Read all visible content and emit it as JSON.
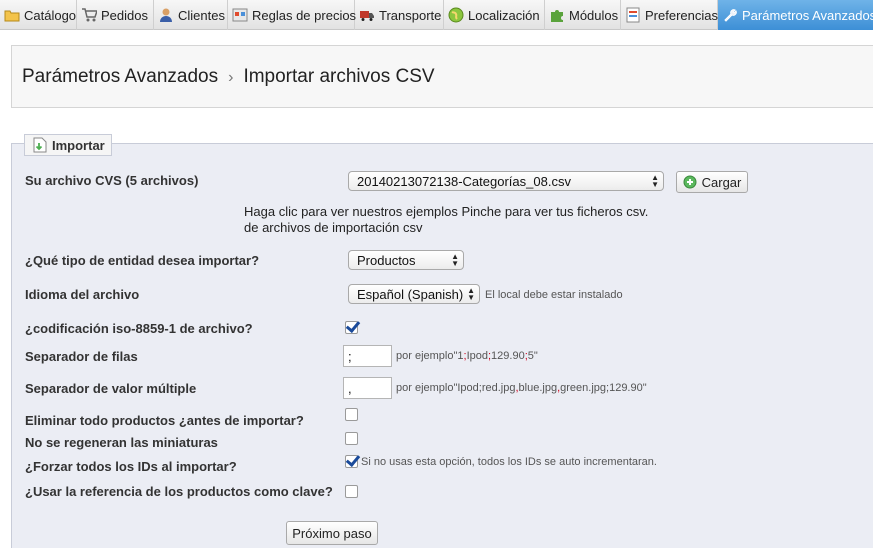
{
  "tabs": [
    {
      "label": "Catálogo",
      "icon": "folder-icon"
    },
    {
      "label": "Pedidos",
      "icon": "cart-icon"
    },
    {
      "label": "Clientes",
      "icon": "user-icon"
    },
    {
      "label": "Reglas de precios",
      "icon": "price-rules-icon"
    },
    {
      "label": "Transporte",
      "icon": "truck-icon"
    },
    {
      "label": "Localización",
      "icon": "globe-icon"
    },
    {
      "label": "Módulos",
      "icon": "puzzle-icon"
    },
    {
      "label": "Preferencias",
      "icon": "preferences-icon"
    },
    {
      "label": "Parámetros Avanzados",
      "icon": "wrench-icon",
      "active": true
    }
  ],
  "breadcrumb": {
    "parent": "Parámetros Avanzados",
    "separator": "›",
    "current": "Importar archivos CSV"
  },
  "panel": {
    "legend": "Importar"
  },
  "form": {
    "file_label": "Su archivo CVS (5 archivos)",
    "file_value": "20140213072138-Categorías_08.csv",
    "upload_button": "Cargar",
    "info_line1": "Haga clic para ver nuestros ejemplos Pinche para ver tus ficheros csv.",
    "info_line2": "de archivos de importación csv",
    "entity_label": "¿Qué tipo de entidad desea importar?",
    "entity_value": "Productos",
    "lang_label": "Idioma del archivo",
    "lang_value": "Español (Spanish)",
    "lang_hint": "El local debe estar instalado",
    "iso_label": "¿codificación iso-8859-1 de archivo?",
    "iso_checked": true,
    "row_sep_label": "Separador de filas",
    "row_sep_value": ";",
    "row_sep_hint_pre": "por ejemplo\"1",
    "row_sep_hint_mid1": "Ipod",
    "row_sep_hint_mid2": "129.90",
    "row_sep_hint_end": "5\"",
    "multi_sep_label": "Separador de valor múltiple",
    "multi_sep_value": ",",
    "multi_sep_hint_pre": "por ejemplo\"Ipod;red.jpg",
    "multi_sep_hint_mid1": "blue.jpg",
    "multi_sep_hint_mid2": "green.jpg;129.90\"",
    "delete_label": "Eliminar todo productos ¿antes de importar?",
    "delete_checked": false,
    "thumbs_label": "No se regeneran las miniaturas",
    "thumbs_checked": false,
    "force_ids_label": "¿Forzar todos los IDs al importar?",
    "force_ids_checked": true,
    "force_ids_hint": "Si no usas esta opción, todos los IDs se auto incrementaran.",
    "ref_key_label": "¿Usar la referencia de los productos como clave?",
    "ref_key_checked": false,
    "next_button": "Próximo paso"
  },
  "colors": {
    "active_tab": "#3d8fd6",
    "panel_bg": "#ebedf4",
    "separator_highlight": "#d0021b"
  }
}
